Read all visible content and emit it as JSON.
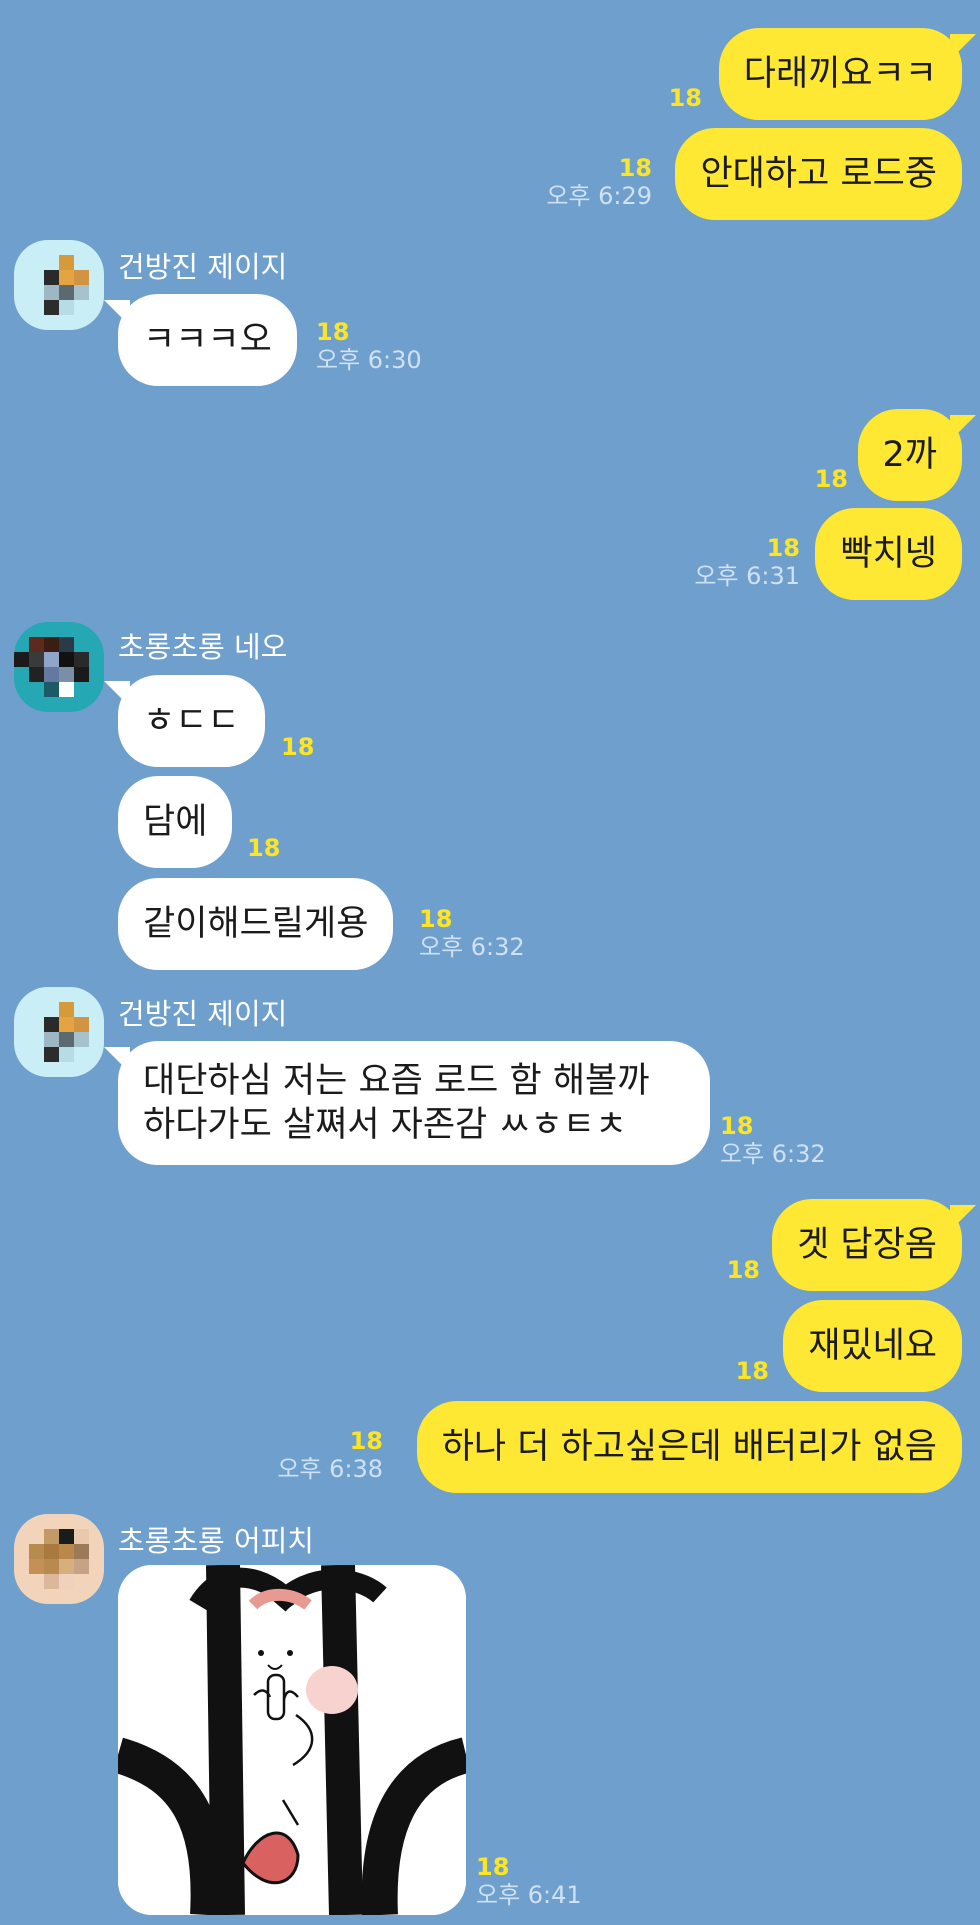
{
  "read_count": "18",
  "contacts": {
    "jay": "건방진 제이지",
    "neo": "초롱초롱 네오",
    "apeach": "초롱초롱 어피치"
  },
  "messages": {
    "m1": "다래끼요ㅋㅋ",
    "m2": "안대하고 로드중",
    "t1": "오후 6:29",
    "m3": "ㅋㅋㅋ오",
    "t2": "오후 6:30",
    "m4": "2까",
    "m5": "빡치넹",
    "t3": "오후 6:31",
    "m6": "ㅎㄷㄷ",
    "m7": "담에",
    "m8": "같이해드릴게용",
    "t4": "오후 6:32",
    "m9_line1": "대단하심 저는 요즘 로드 함 해볼까",
    "m9_line2": "하다가도 살쪄서 자존감 ㅆㅎㅌㅊ",
    "t5": "오후 6:32",
    "m10": "겟 답장옴",
    "m11": "재밌네요",
    "m12": "하나 더 하고싶은데 배터리가 없음",
    "t6": "오후 6:38",
    "t7": "오후 6:41"
  },
  "colors": {
    "background": "#6e9fcd",
    "my_bubble": "#fee834",
    "their_bubble": "#ffffff",
    "read_count": "#fbe526"
  }
}
